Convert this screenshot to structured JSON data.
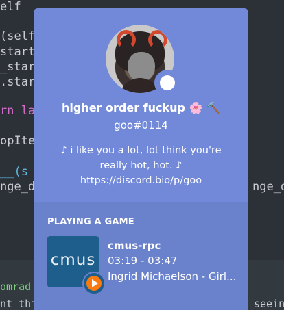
{
  "editor": {
    "left_lines": [
      {
        "text": "elf",
        "kind": "plain"
      },
      {
        "text": "(self",
        "kind": "plain"
      },
      {
        "text": "start",
        "kind": "plain"
      },
      {
        "text": "_star",
        "kind": "plain"
      },
      {
        "text": ".star",
        "kind": "plain"
      },
      {
        "text": "rn la",
        "kind": "kw"
      },
      {
        "text": "opIte",
        "kind": "plain"
      },
      {
        "text": "__(s",
        "kind": "fn"
      },
      {
        "text": "nge_d",
        "kind": "plain"
      }
    ],
    "right_fragment": "nge_d",
    "bottom_left_1": "omrad",
    "bottom_left_2": "nt thi",
    "bottom_right": "seein"
  },
  "profile": {
    "username": "higher order fuckup 🌸 🔨",
    "tag": "goo#0114",
    "bio_lines": [
      "♪ i like you a lot, lot think you're",
      "really hot, hot. ♪",
      "https://discord.bio/p/goo"
    ],
    "status": "online"
  },
  "activity": {
    "section_title": "PLAYING A GAME",
    "icon_label": "cmus",
    "name": "cmus-rpc",
    "details": "03:19 - 03:47",
    "state": "Ingrid Michaelson - Girl..."
  },
  "colors": {
    "card": "#7289da",
    "activity_bg": "#6a81cc",
    "editor_bg": "#2c3037"
  }
}
